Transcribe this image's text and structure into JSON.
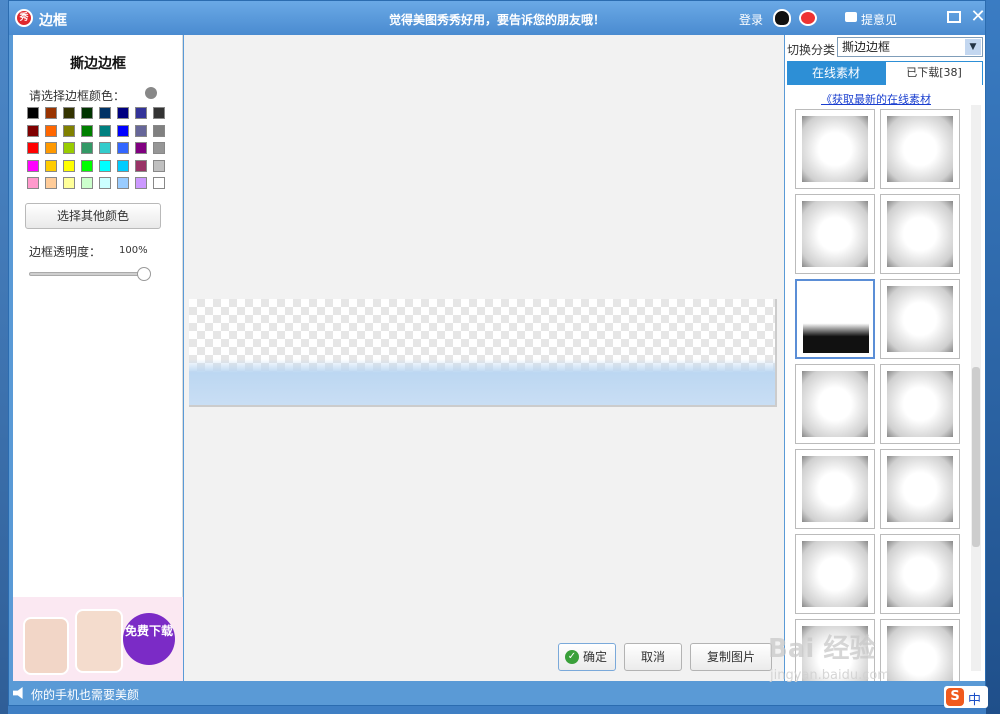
{
  "window": {
    "logo_text": "秀",
    "title": "边框",
    "slogan": "觉得美图秀秀好用，要告诉您的朋友哦！",
    "login_label": "登录",
    "feedback_label": "提意见",
    "close_glyph": "✕"
  },
  "left_panel": {
    "title": "撕边边框",
    "color_label": "请选择边框颜色：",
    "swatch_colors": [
      "#000000",
      "#993300",
      "#333300",
      "#003300",
      "#003366",
      "#000080",
      "#333399",
      "#333333",
      "#800000",
      "#FF6600",
      "#808000",
      "#008000",
      "#008080",
      "#0000FF",
      "#666699",
      "#808080",
      "#FF0000",
      "#FF9900",
      "#99CC00",
      "#339966",
      "#33CCCC",
      "#3366FF",
      "#800080",
      "#969696",
      "#FF00FF",
      "#FFCC00",
      "#FFFF00",
      "#00FF00",
      "#00FFFF",
      "#00CCFF",
      "#993366",
      "#C0C0C0",
      "#FF99CC",
      "#FFCC99",
      "#FFFF99",
      "#CCFFCC",
      "#CCFFFF",
      "#99CCFF",
      "#CC99FF",
      "#FFFFFF"
    ],
    "other_color_button": "选择其他颜色",
    "opacity_label": "边框透明度：",
    "opacity_value": "100%",
    "opacity_fraction": 1.0,
    "ad_badge": "免费下载"
  },
  "canvas": {
    "ok_button": "确定",
    "cancel_button": "取消",
    "copy_button": "复制图片"
  },
  "right_panel": {
    "category_label": "切换分类",
    "category_selected": "撕边边框",
    "tab_online": "在线素材",
    "tab_downloaded": "已下载[38]",
    "get_more_link": "《获取最新的在线素材",
    "thumbnails": [
      "frame",
      "frame",
      "frame",
      "frame",
      "frame",
      "frame",
      "frame",
      "frame",
      "frame",
      "frame",
      "frame",
      "frame",
      "frame",
      "frame"
    ],
    "selected_index": 4
  },
  "status_bar": {
    "text": "你的手机也需要美颜"
  },
  "watermark": {
    "text": "Bai 经验",
    "url": "jingyan.baidu.com"
  },
  "ime": {
    "logo": "S",
    "mode": "中"
  },
  "colors": {
    "accent": "#2d8fd6",
    "titlebar": "#4a8bd0",
    "strip_grass": "#bcd7f2"
  }
}
